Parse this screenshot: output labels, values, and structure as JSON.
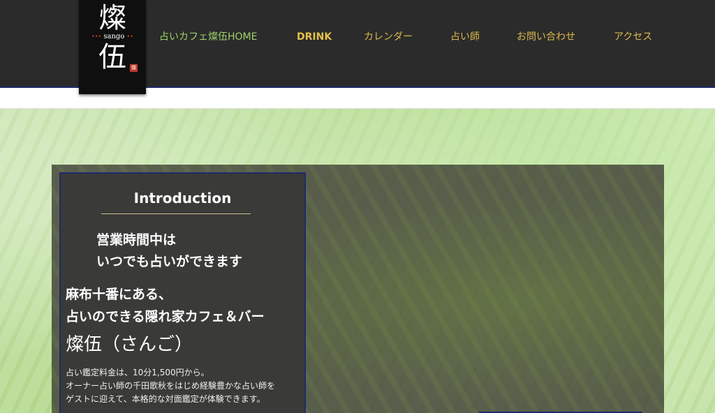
{
  "logo": {
    "char_top": "燦",
    "romaji": "sango",
    "char_bottom": "伍",
    "seal": "燦"
  },
  "nav": {
    "items": [
      {
        "label": "占いカフェ燦伍HOME"
      },
      {
        "label": "DRINK"
      },
      {
        "label": "カレンダー"
      },
      {
        "label": "占い師"
      },
      {
        "label": "お問い合わせ"
      },
      {
        "label": "アクセス"
      }
    ]
  },
  "intro": {
    "title": "Introduction",
    "hours_line1": "営業時間中は",
    "hours_line2": "いつでも占いができます",
    "tagline_line1": "麻布十番にある、",
    "tagline_line2": "占いのできる隠れ家カフェ＆バー",
    "brand": "燦伍（さんご）",
    "desc_line1": "占い鑑定料金は、10分1,500円から。",
    "desc_line2": "オーナー占い師の千田歌秋をはじめ経験豊かな占い師を",
    "desc_line3": "ゲストに迎えて、本格的な対面鑑定が体験できます。"
  },
  "colors": {
    "header_bg": "#2b2b2b",
    "nav_gold": "#d9b84a",
    "nav_home_green": "#9ed36a",
    "accent_navy": "#1f2a6b"
  }
}
